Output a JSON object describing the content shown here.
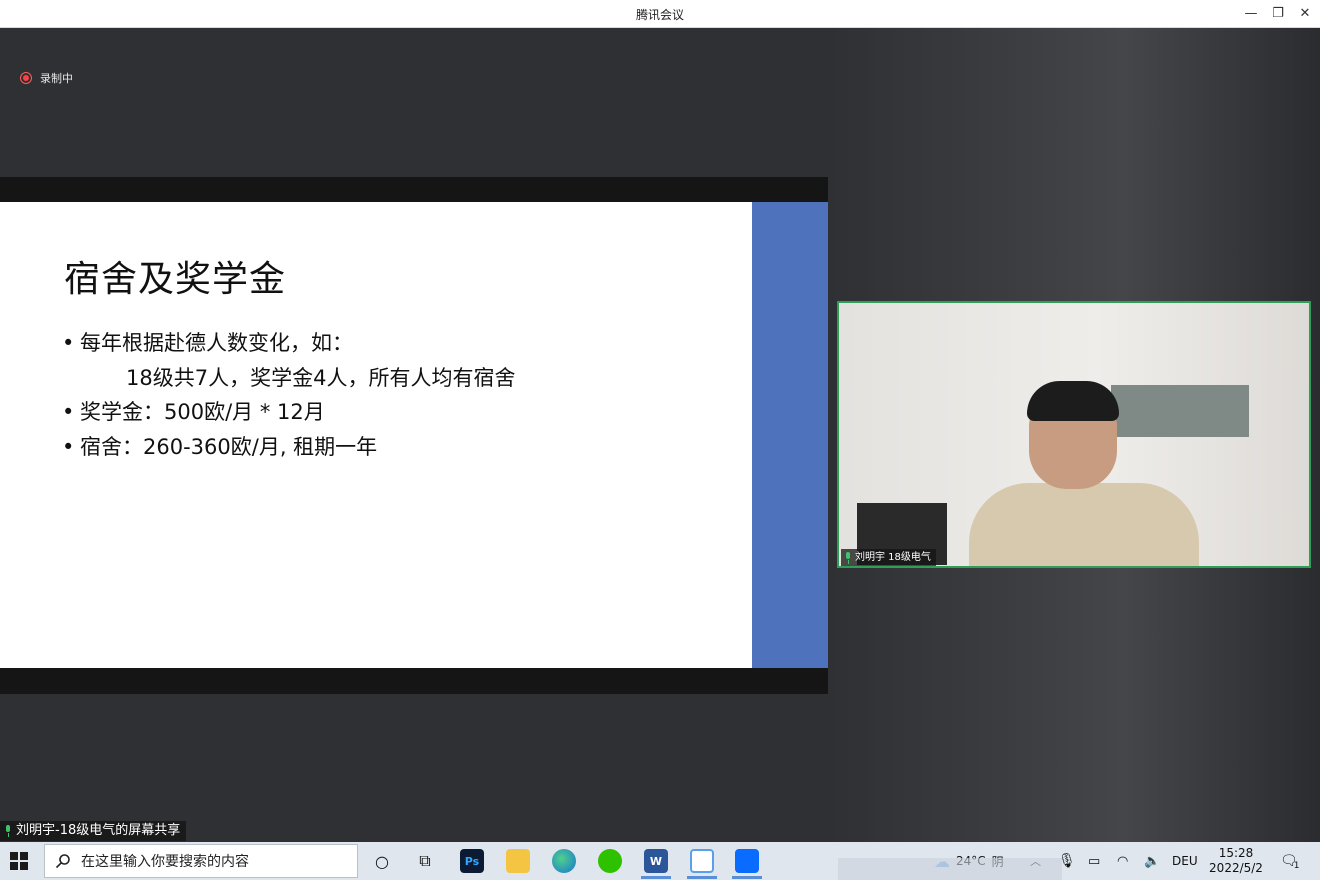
{
  "window": {
    "title": "腾讯会议",
    "minimize": "—",
    "restore": "❐",
    "close": "✕"
  },
  "recording": {
    "label": "录制中",
    "color": "#ff4040"
  },
  "slide": {
    "title": "宿舍及奖学金",
    "bullets": [
      {
        "text": "每年根据赴德人数变化，如："
      },
      {
        "text": "18级共7人，奖学金4人，所有人均有宿舍",
        "indent": true
      },
      {
        "text": "奖学金：500欧/月 * 12月"
      },
      {
        "text": "宿舍：260-360欧/月, 租期一年"
      }
    ],
    "accent_color": "#4f72bc"
  },
  "share_label": "刘明宇-18级电气的屏幕共享",
  "video": {
    "participant_name": "刘明宇 18级电气",
    "border_color": "#2f9e56"
  },
  "taskbar": {
    "search_placeholder": "在这里输入你要搜索的内容",
    "apps": [
      {
        "name": "cortana-icon",
        "label": "○"
      },
      {
        "name": "task-view-icon",
        "label": "⧉"
      },
      {
        "name": "photoshop-icon",
        "label": "Ps"
      },
      {
        "name": "file-explorer-icon",
        "label": ""
      },
      {
        "name": "edge-icon",
        "label": ""
      },
      {
        "name": "wechat-icon",
        "label": ""
      },
      {
        "name": "word-icon",
        "label": "W"
      },
      {
        "name": "baidu-netdisk-icon",
        "label": ""
      },
      {
        "name": "tencent-meeting-icon",
        "label": ""
      }
    ],
    "weather": {
      "temp": "24°C",
      "desc": "阴"
    },
    "language": "DEU",
    "time": "15:28",
    "date": "2022/5/2",
    "notification_count": "1"
  }
}
